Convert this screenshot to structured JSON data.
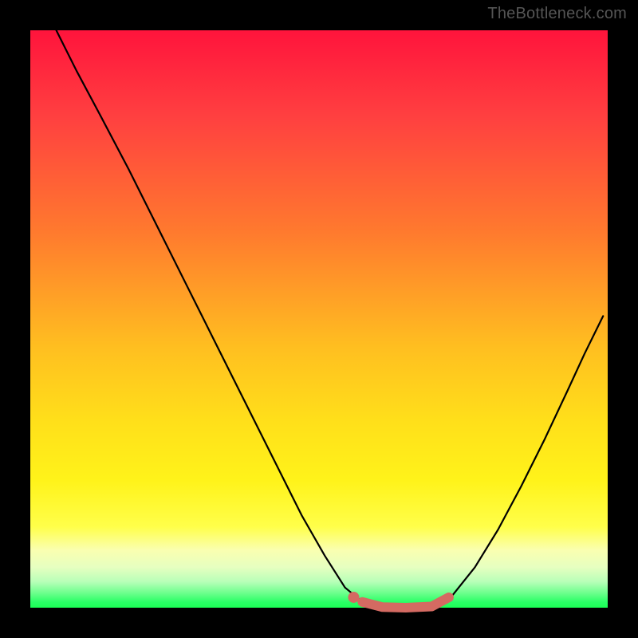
{
  "attribution": "TheBottleneck.com",
  "chart_data": {
    "type": "line",
    "title": "",
    "xlabel": "",
    "ylabel": "",
    "xlim": [
      0,
      1
    ],
    "ylim": [
      0,
      1
    ],
    "series": [
      {
        "name": "curve",
        "color": "#000000",
        "stroke_width": 2.2,
        "points": [
          {
            "x": 0.045,
            "y": 1.0
          },
          {
            "x": 0.08,
            "y": 0.93
          },
          {
            "x": 0.12,
            "y": 0.855
          },
          {
            "x": 0.17,
            "y": 0.76
          },
          {
            "x": 0.22,
            "y": 0.66
          },
          {
            "x": 0.27,
            "y": 0.56
          },
          {
            "x": 0.32,
            "y": 0.46
          },
          {
            "x": 0.37,
            "y": 0.36
          },
          {
            "x": 0.42,
            "y": 0.26
          },
          {
            "x": 0.47,
            "y": 0.16
          },
          {
            "x": 0.51,
            "y": 0.09
          },
          {
            "x": 0.545,
            "y": 0.035
          },
          {
            "x": 0.575,
            "y": 0.01
          },
          {
            "x": 0.61,
            "y": 0.0
          },
          {
            "x": 0.65,
            "y": 0.0
          },
          {
            "x": 0.695,
            "y": 0.002
          },
          {
            "x": 0.73,
            "y": 0.02
          },
          {
            "x": 0.77,
            "y": 0.07
          },
          {
            "x": 0.81,
            "y": 0.135
          },
          {
            "x": 0.85,
            "y": 0.21
          },
          {
            "x": 0.89,
            "y": 0.29
          },
          {
            "x": 0.93,
            "y": 0.375
          },
          {
            "x": 0.96,
            "y": 0.44
          },
          {
            "x": 0.992,
            "y": 0.505
          }
        ]
      },
      {
        "name": "highlight-segment",
        "color": "#d46a62",
        "stroke_width": 12,
        "points": [
          {
            "x": 0.575,
            "y": 0.01
          },
          {
            "x": 0.61,
            "y": 0.001
          },
          {
            "x": 0.65,
            "y": 0.0
          },
          {
            "x": 0.695,
            "y": 0.002
          },
          {
            "x": 0.725,
            "y": 0.018
          }
        ]
      }
    ],
    "markers": [
      {
        "name": "highlight-dot",
        "x": 0.56,
        "y": 0.018,
        "r": 7,
        "color": "#d46a62"
      }
    ]
  }
}
